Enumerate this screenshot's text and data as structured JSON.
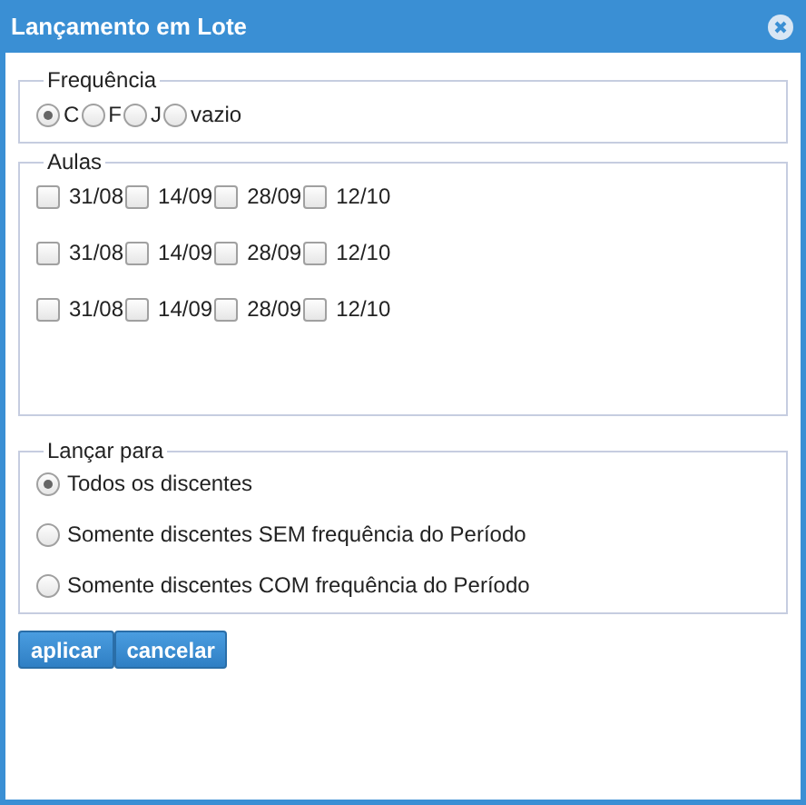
{
  "window": {
    "title": "Lançamento em Lote"
  },
  "frequencia": {
    "legend": "Frequência",
    "options": [
      {
        "label": "C",
        "selected": true
      },
      {
        "label": "F",
        "selected": false
      },
      {
        "label": "J",
        "selected": false
      },
      {
        "label": "vazio",
        "selected": false
      }
    ]
  },
  "aulas": {
    "legend": "Aulas",
    "rows": [
      [
        {
          "label": "31/08",
          "checked": false
        },
        {
          "label": "14/09",
          "checked": false
        },
        {
          "label": "28/09",
          "checked": false
        },
        {
          "label": "12/10",
          "checked": false
        }
      ],
      [
        {
          "label": "31/08",
          "checked": false
        },
        {
          "label": "14/09",
          "checked": false
        },
        {
          "label": "28/09",
          "checked": false
        },
        {
          "label": "12/10",
          "checked": false
        }
      ],
      [
        {
          "label": "31/08",
          "checked": false
        },
        {
          "label": "14/09",
          "checked": false
        },
        {
          "label": "28/09",
          "checked": false
        },
        {
          "label": "12/10",
          "checked": false
        }
      ]
    ]
  },
  "lancar_para": {
    "legend": "Lançar para",
    "options": [
      {
        "label": "Todos os discentes",
        "selected": true
      },
      {
        "label": "Somente discentes SEM frequência do Período",
        "selected": false
      },
      {
        "label": "Somente discentes COM frequência do Período",
        "selected": false
      }
    ]
  },
  "buttons": [
    "aplicar",
    "cancelar"
  ]
}
